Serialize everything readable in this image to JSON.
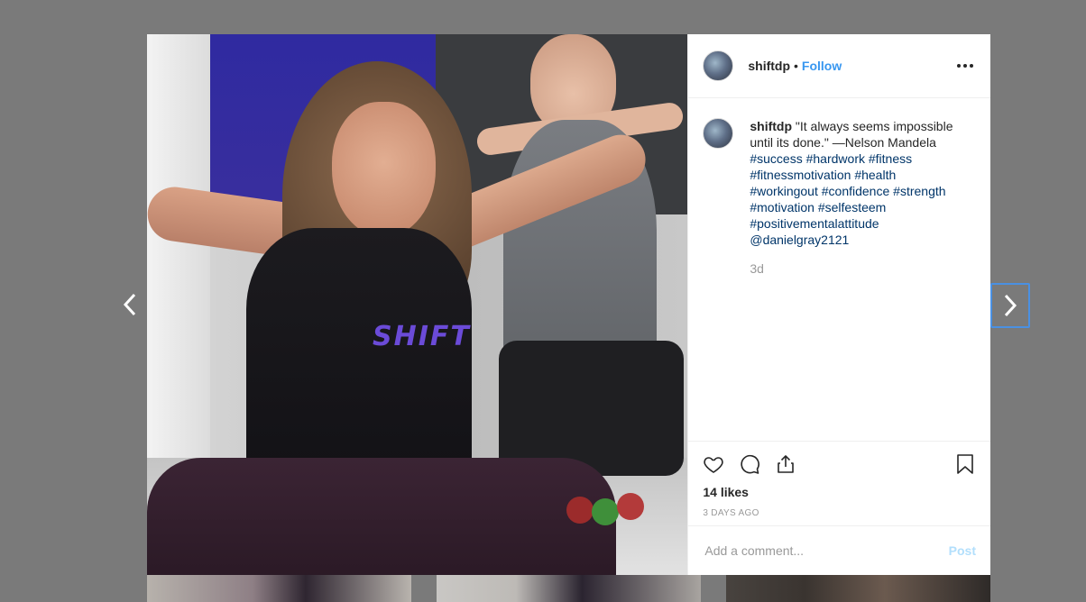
{
  "post": {
    "username": "shiftdp",
    "separator": "•",
    "follow_label": "Follow",
    "caption_user": "shiftdp",
    "caption_text": "\"It always seems impossible until its done.\" —Nelson Mandela",
    "hashtags": [
      "#success",
      "#hardwork",
      "#fitness",
      "#fitnessmotivation",
      "#health",
      "#workingout",
      "#confidence",
      "#strength",
      "#motivation",
      "#selfesteem",
      "#positivementalattitude",
      "@danielgray2121"
    ],
    "relative_time": "3d",
    "likes": "14 likes",
    "date_ago": "3 DAYS AGO",
    "image_overlay_text": "SHIFT"
  },
  "comment": {
    "placeholder": "Add a comment...",
    "post_label": "Post"
  },
  "icons": {
    "prev": "chevron-left-icon",
    "next": "chevron-right-icon",
    "more": "more-options-icon",
    "like": "heart-icon",
    "comment": "comment-icon",
    "share": "share-icon",
    "save": "bookmark-icon"
  },
  "colors": {
    "accent": "#3897f0",
    "hashtag": "#003569",
    "backdrop": "#7a7a7a",
    "post_disabled": "#b2dffc"
  }
}
